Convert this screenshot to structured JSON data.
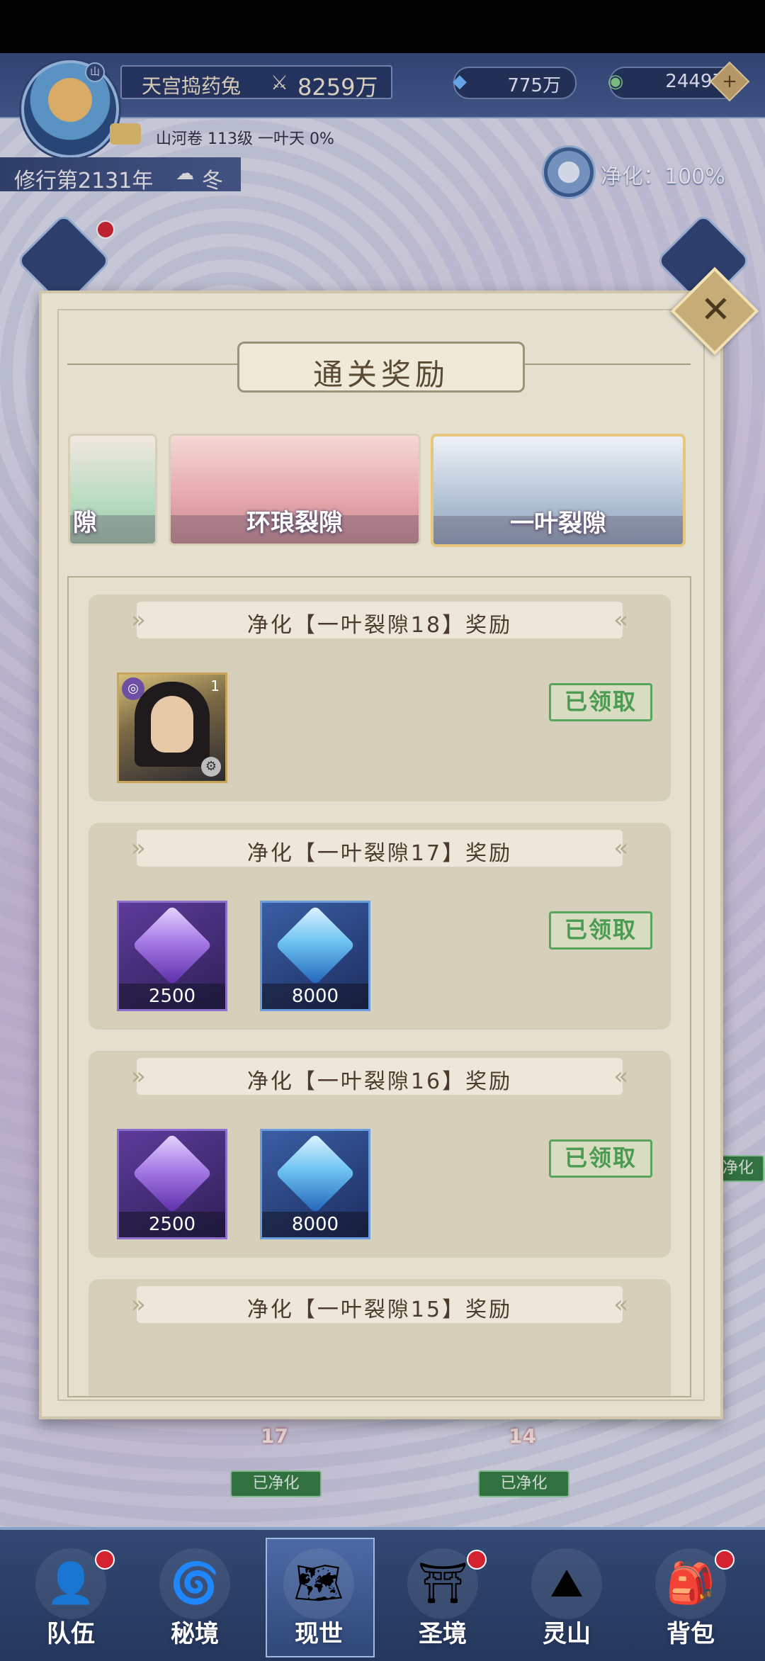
{
  "player": {
    "name": "天宫捣药兔",
    "power": "8259万",
    "avatar_mark": "山",
    "subline": "山河卷 113级 一叶天 0%"
  },
  "resources": {
    "spirit_crystal": "775万",
    "jade": "24497"
  },
  "calendar": {
    "year_text": "修行第2131年",
    "season": "冬"
  },
  "purification": {
    "label": "净化：100%"
  },
  "modal": {
    "title": "通关奖励",
    "close_glyph": "✕",
    "tabs": [
      {
        "label": "隙"
      },
      {
        "label": "环琅裂隙"
      },
      {
        "label": "一叶裂隙"
      }
    ],
    "rewards": [
      {
        "title": "净化【一叶裂隙18】奖励",
        "items": [
          {
            "kind": "hero",
            "count": "1"
          }
        ],
        "status": "已领取"
      },
      {
        "title": "净化【一叶裂隙17】奖励",
        "items": [
          {
            "kind": "purple-crystal",
            "qty": "2500"
          },
          {
            "kind": "blue-crystal",
            "qty": "8000"
          }
        ],
        "status": "已领取"
      },
      {
        "title": "净化【一叶裂隙16】奖励",
        "items": [
          {
            "kind": "purple-crystal",
            "qty": "2500"
          },
          {
            "kind": "blue-crystal",
            "qty": "8000"
          }
        ],
        "status": "已领取"
      },
      {
        "title": "净化【一叶裂隙15】奖励",
        "items": [],
        "status": ""
      }
    ]
  },
  "map": {
    "badge_left": "已净化",
    "badge_right": "已净化",
    "num_left": "17",
    "num_right": "14",
    "side_badge": "净化"
  },
  "nav": [
    {
      "label": "队伍",
      "icon": "team-icon",
      "glyph": "👤"
    },
    {
      "label": "秘境",
      "icon": "realm-icon",
      "glyph": "🌀"
    },
    {
      "label": "现世",
      "icon": "world-map-icon",
      "glyph": "🗺"
    },
    {
      "label": "圣境",
      "icon": "temple-icon",
      "glyph": "⛩"
    },
    {
      "label": "灵山",
      "icon": "mountain-icon",
      "glyph": "⛰"
    },
    {
      "label": "背包",
      "icon": "bag-icon",
      "glyph": "🎒"
    }
  ],
  "colors": {
    "claimed_green": "#4b9b52",
    "modal_bg": "#e4dfcf",
    "hud_blue": "#2f4778"
  }
}
